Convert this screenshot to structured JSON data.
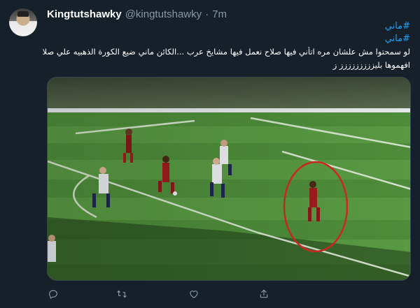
{
  "tweet": {
    "author_name": "Kingtutshawky",
    "author_handle": "@kingtutshawky",
    "separator": "·",
    "time": "7m",
    "hashtags": [
      "#ماني",
      "#ماني"
    ],
    "text_lines": [
      "لو سمحتوا مش علشان مره اتأني فيها صلاح نعمل فيها مشايخ عرب ...الكائن ماني ضيع الكورة الذهبيه علي صلاح الموسم دا",
      "افهموها بليززززززززز ز"
    ]
  },
  "colors": {
    "background": "#15202b",
    "hashtag": "#1da1f2",
    "secondary_text": "#8899a6"
  },
  "actions": [
    {
      "name": "reply",
      "icon": "reply-icon"
    },
    {
      "name": "retweet",
      "icon": "retweet-icon"
    },
    {
      "name": "like",
      "icon": "heart-icon"
    },
    {
      "name": "share",
      "icon": "share-icon"
    }
  ]
}
